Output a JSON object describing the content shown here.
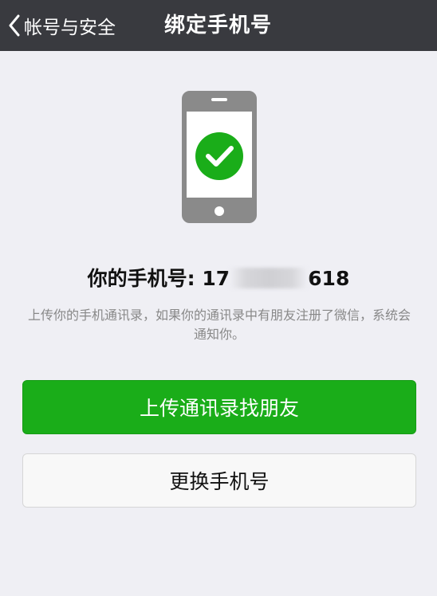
{
  "navbar": {
    "back_label": "帐号与安全",
    "title": "绑定手机号"
  },
  "phone_info": {
    "label": "你的手机号: 17",
    "number_suffix": "618"
  },
  "hint": "上传你的手机通讯录，如果你的通讯录中有朋友注册了微信，系统会通知你。",
  "buttons": {
    "upload_contacts": "上传通讯录找朋友",
    "change_number": "更换手机号"
  },
  "colors": {
    "navbar_bg": "#393a3f",
    "primary_green": "#1aad19",
    "page_bg": "#efeff4",
    "phone_gray": "#8a8a8a"
  },
  "icons": {
    "back": "chevron-left-icon",
    "check": "check-circle-icon",
    "phone": "smartphone-icon"
  }
}
